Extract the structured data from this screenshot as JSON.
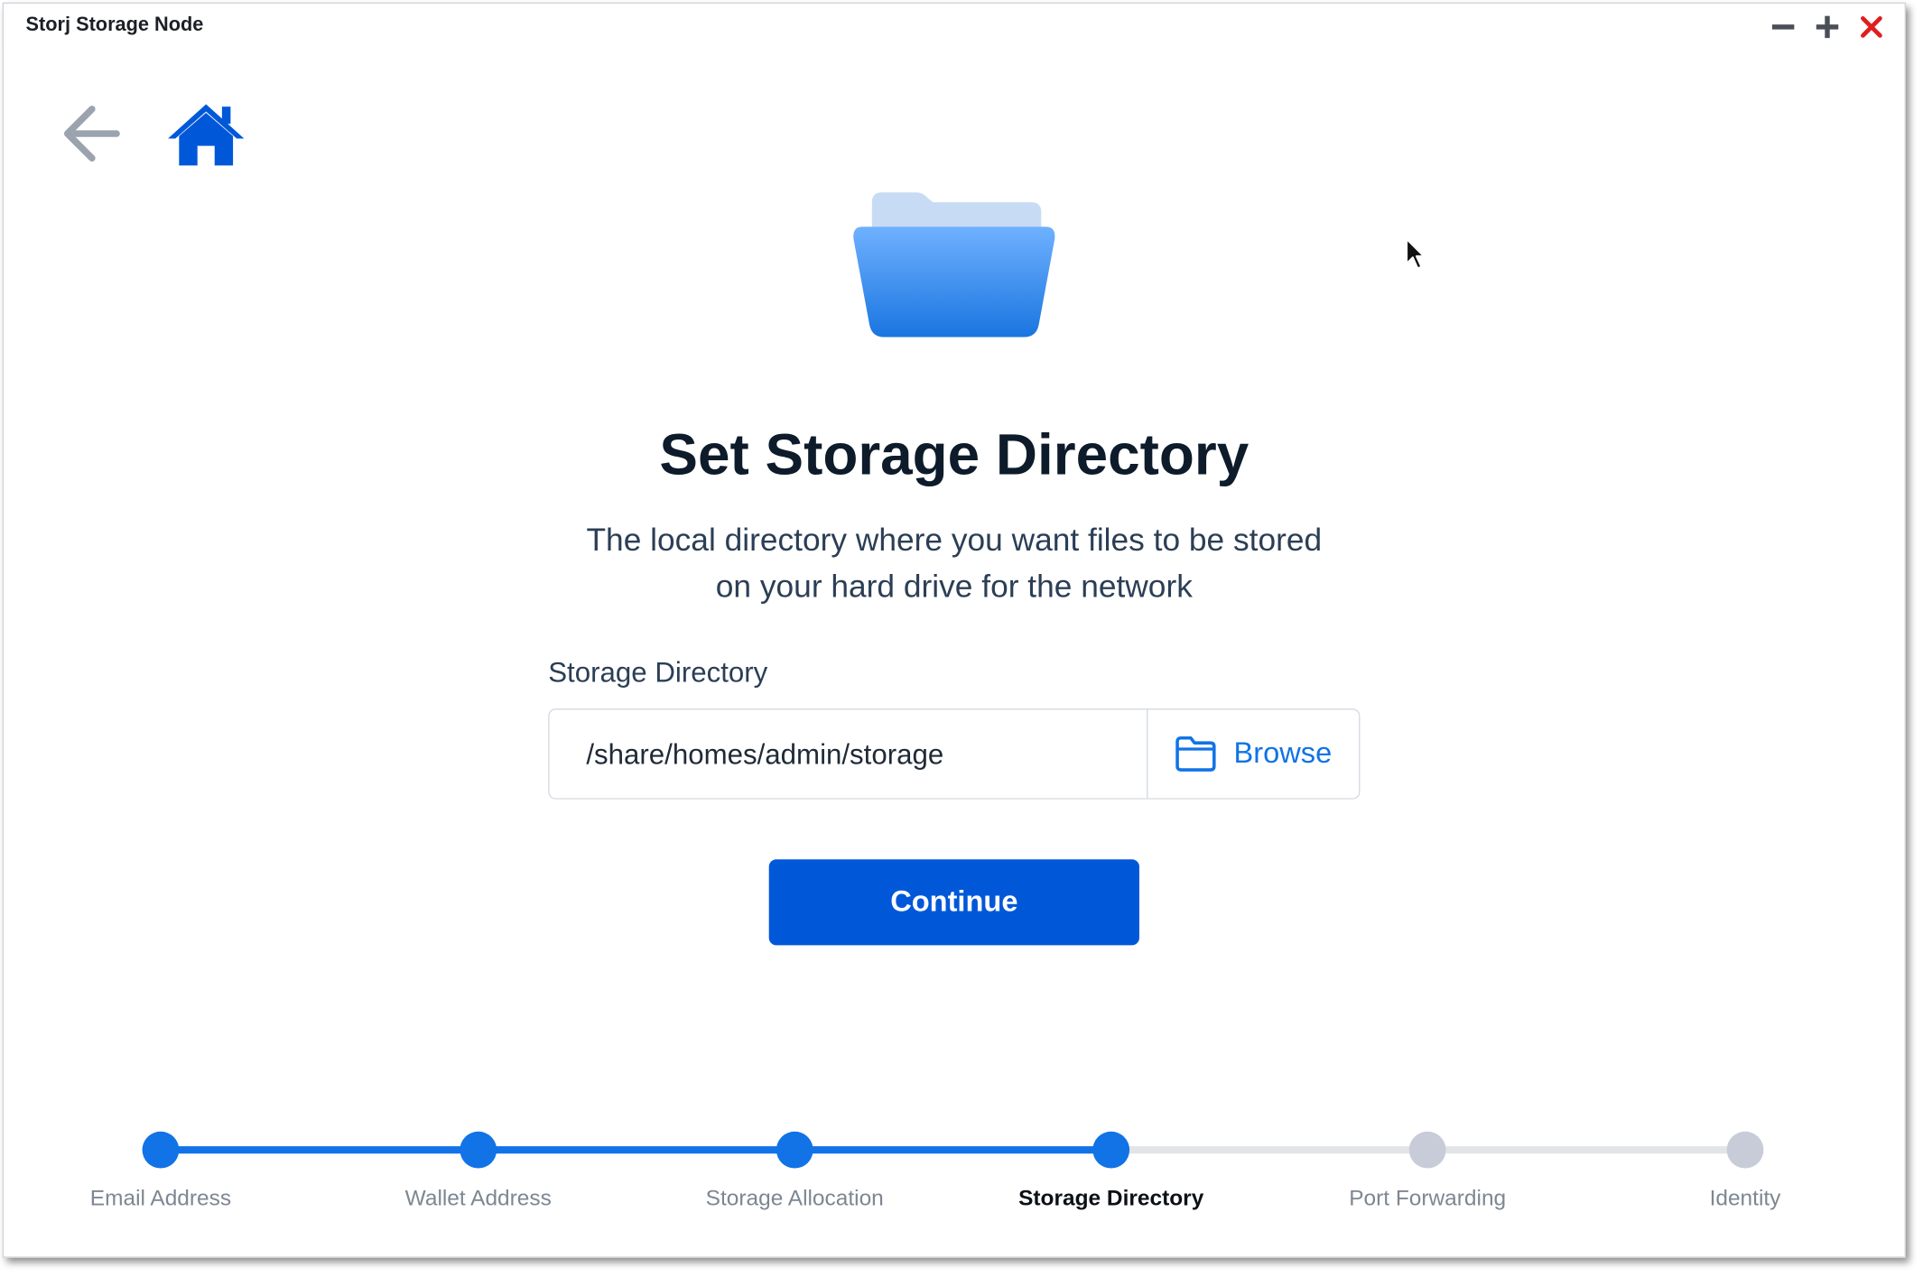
{
  "window": {
    "title": "Storj Storage Node"
  },
  "page": {
    "heading": "Set Storage Directory",
    "subtitle_line1": "The local directory where you want files to be stored",
    "subtitle_line2": "on your hard drive for the network"
  },
  "form": {
    "field_label": "Storage Directory",
    "directory_value": "/share/homes/admin/storage",
    "browse_label": "Browse",
    "continue_label": "Continue"
  },
  "steps": [
    {
      "label": "Email Address",
      "state": "done"
    },
    {
      "label": "Wallet Address",
      "state": "done"
    },
    {
      "label": "Storage Allocation",
      "state": "done"
    },
    {
      "label": "Storage Directory",
      "state": "active"
    },
    {
      "label": "Port Forwarding",
      "state": "pending"
    },
    {
      "label": "Identity",
      "state": "pending"
    }
  ],
  "icons": {
    "back": "arrow-left-icon",
    "home": "home-icon",
    "hero": "folder-icon",
    "browse": "folder-outline-icon",
    "minimize": "minus-icon",
    "maximize": "plus-icon",
    "close": "close-icon"
  },
  "colors": {
    "accent": "#0058d9",
    "step_done": "#1173e6",
    "step_pending": "#c8ccd9",
    "close_red": "#e11d1d"
  }
}
